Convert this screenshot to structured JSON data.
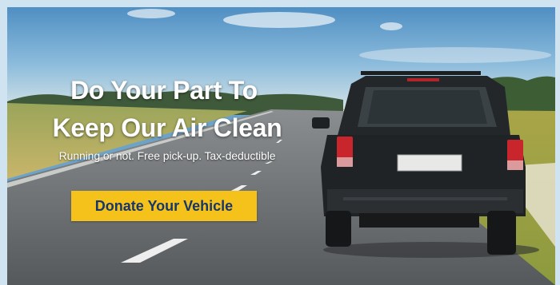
{
  "hero": {
    "title_line1": "Do Your Part To",
    "title_line2": "Keep Our Air Clean",
    "subtitle": "Running or not. Free pick-up. Tax-deductible",
    "cta_label": "Donate Your Vehicle"
  },
  "colors": {
    "cta_background": "#f5c21b",
    "cta_text": "#17366c",
    "page_background": "#cfe3f1"
  }
}
